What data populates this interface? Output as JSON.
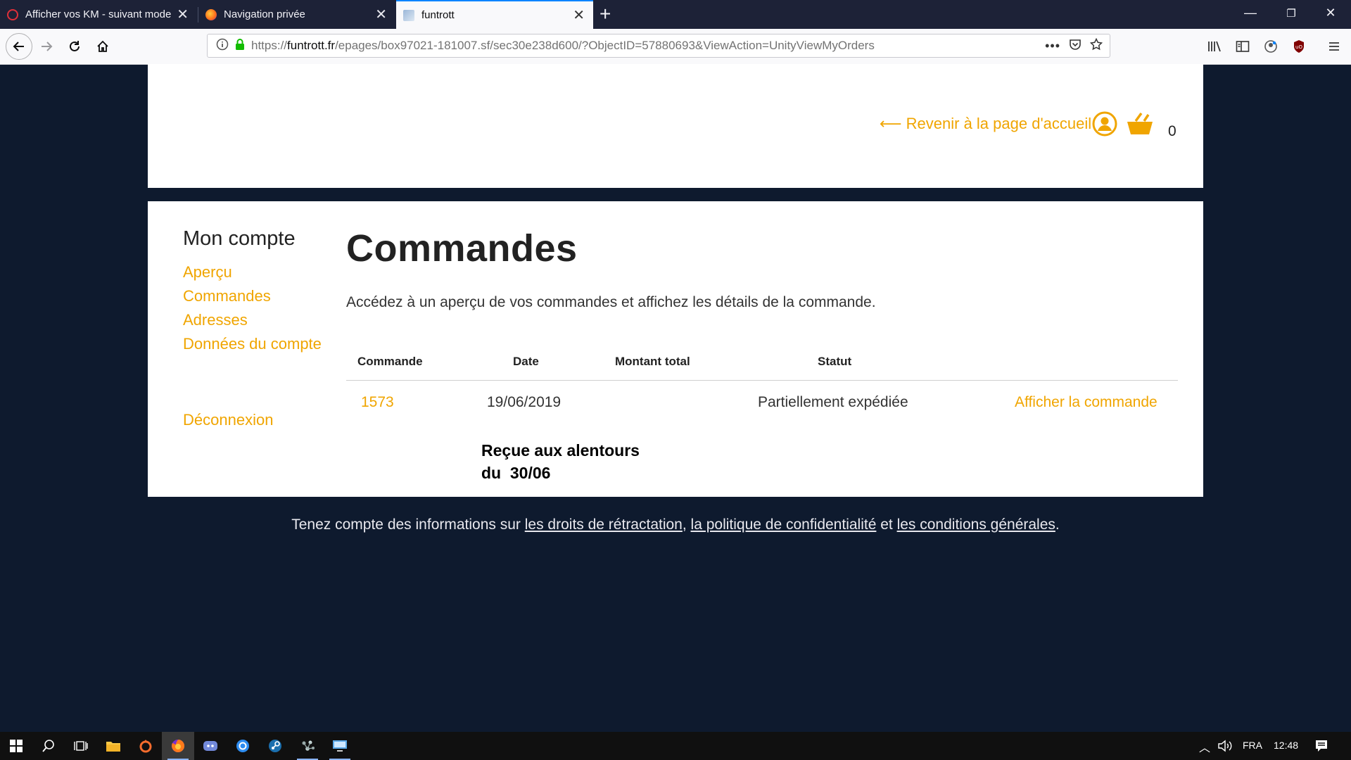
{
  "browser": {
    "tabs": [
      {
        "title": "Afficher vos KM - suivant mode",
        "favicon": "opera-icon"
      },
      {
        "title": "Navigation privée",
        "favicon": "firefox-icon"
      },
      {
        "title": "funtrott",
        "favicon": "funtrott-icon",
        "active": true
      }
    ],
    "url": {
      "prefix": "https://",
      "domain": "funtrott.fr",
      "path": "/epages/box97021-181007.sf/sec30e238d600/?ObjectID=57880693&ViewAction=UnityViewMyOrders"
    }
  },
  "header": {
    "back_link": "⟵ Revenir à la page d'accueil",
    "cart_count": "0"
  },
  "sidebar": {
    "title": "Mon compte",
    "items": [
      "Aperçu",
      "Commandes",
      "Adresses",
      "Données du compte"
    ],
    "logout": "Déconnexion"
  },
  "main": {
    "title": "Commandes",
    "description": "Accédez à un aperçu de vos commandes et affichez les détails de la commande.",
    "columns": [
      "Commande",
      "Date",
      "Montant total",
      "Statut"
    ],
    "rows": [
      {
        "order": "1573",
        "date": "19/06/2019",
        "total": "",
        "status": "Partiellement expédiée",
        "action": "Afficher la commande"
      }
    ],
    "note": "Reçue aux alentours\ndu  30/06"
  },
  "footer": {
    "prefix": "Tenez compte des informations sur ",
    "link1": "les droits de rétractation",
    "sep1": ", ",
    "link2": "la politique de confidentialité",
    "sep2": " et ",
    "link3": "les conditions générales",
    "suffix": "."
  },
  "taskbar": {
    "language": "FRA",
    "time": "12:48"
  },
  "colors": {
    "accent": "#f0a500",
    "page_bg": "#0e1a2e",
    "tab_active_border": "#0a84ff"
  }
}
